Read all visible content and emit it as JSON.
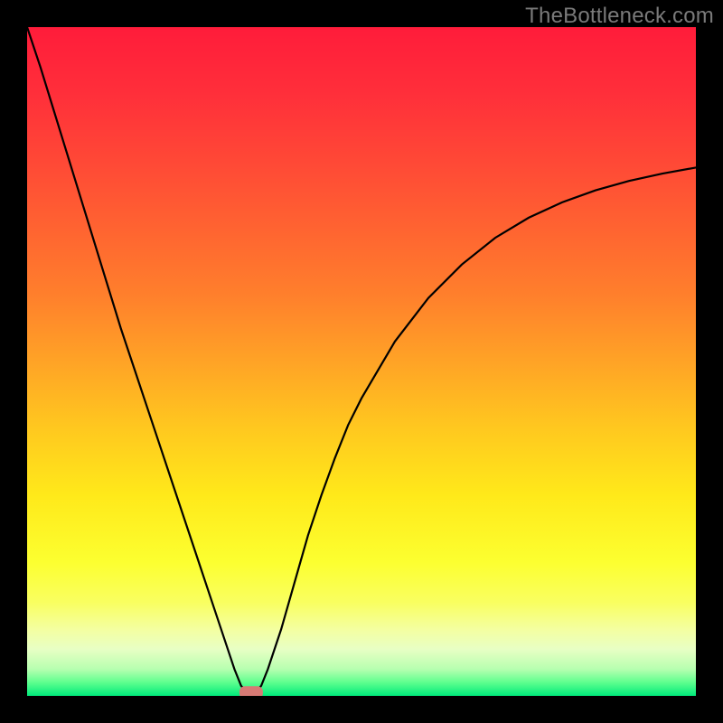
{
  "attribution": "TheBottleneck.com",
  "chart_data": {
    "type": "line",
    "title": "",
    "xlabel": "",
    "ylabel": "",
    "xlim": [
      0,
      100
    ],
    "ylim": [
      0,
      100
    ],
    "series": [
      {
        "name": "bottleneck-curve",
        "x": [
          0,
          2,
          4,
          6,
          8,
          10,
          12,
          14,
          16,
          18,
          20,
          22,
          24,
          26,
          28,
          30,
          31,
          32,
          33,
          34,
          35,
          36,
          38,
          40,
          42,
          44,
          46,
          48,
          50,
          55,
          60,
          65,
          70,
          75,
          80,
          85,
          90,
          95,
          100
        ],
        "y": [
          100,
          94,
          87.5,
          81,
          74.5,
          68,
          61.5,
          55,
          49,
          43,
          37,
          31,
          25,
          19,
          13,
          7,
          4,
          1.5,
          0.5,
          0.5,
          1.5,
          4,
          10,
          17,
          24,
          30,
          35.5,
          40.5,
          44.5,
          53,
          59.5,
          64.5,
          68.5,
          71.5,
          73.8,
          75.6,
          77,
          78.1,
          79
        ]
      }
    ],
    "marker": {
      "x": 33.5,
      "y": 0.5,
      "color": "#d77a75"
    },
    "gradient_stops": [
      {
        "pct": 0,
        "color": "#ff1c3a"
      },
      {
        "pct": 10,
        "color": "#ff2f3a"
      },
      {
        "pct": 20,
        "color": "#ff4836"
      },
      {
        "pct": 30,
        "color": "#ff6331"
      },
      {
        "pct": 40,
        "color": "#ff7f2c"
      },
      {
        "pct": 50,
        "color": "#ffa326"
      },
      {
        "pct": 60,
        "color": "#ffc81f"
      },
      {
        "pct": 70,
        "color": "#ffe91a"
      },
      {
        "pct": 80,
        "color": "#fcff30"
      },
      {
        "pct": 86,
        "color": "#f9ff60"
      },
      {
        "pct": 90,
        "color": "#f4ffa0"
      },
      {
        "pct": 93,
        "color": "#e8ffc4"
      },
      {
        "pct": 96,
        "color": "#b7ffb0"
      },
      {
        "pct": 98,
        "color": "#5dff8e"
      },
      {
        "pct": 100,
        "color": "#00ea7b"
      }
    ]
  }
}
